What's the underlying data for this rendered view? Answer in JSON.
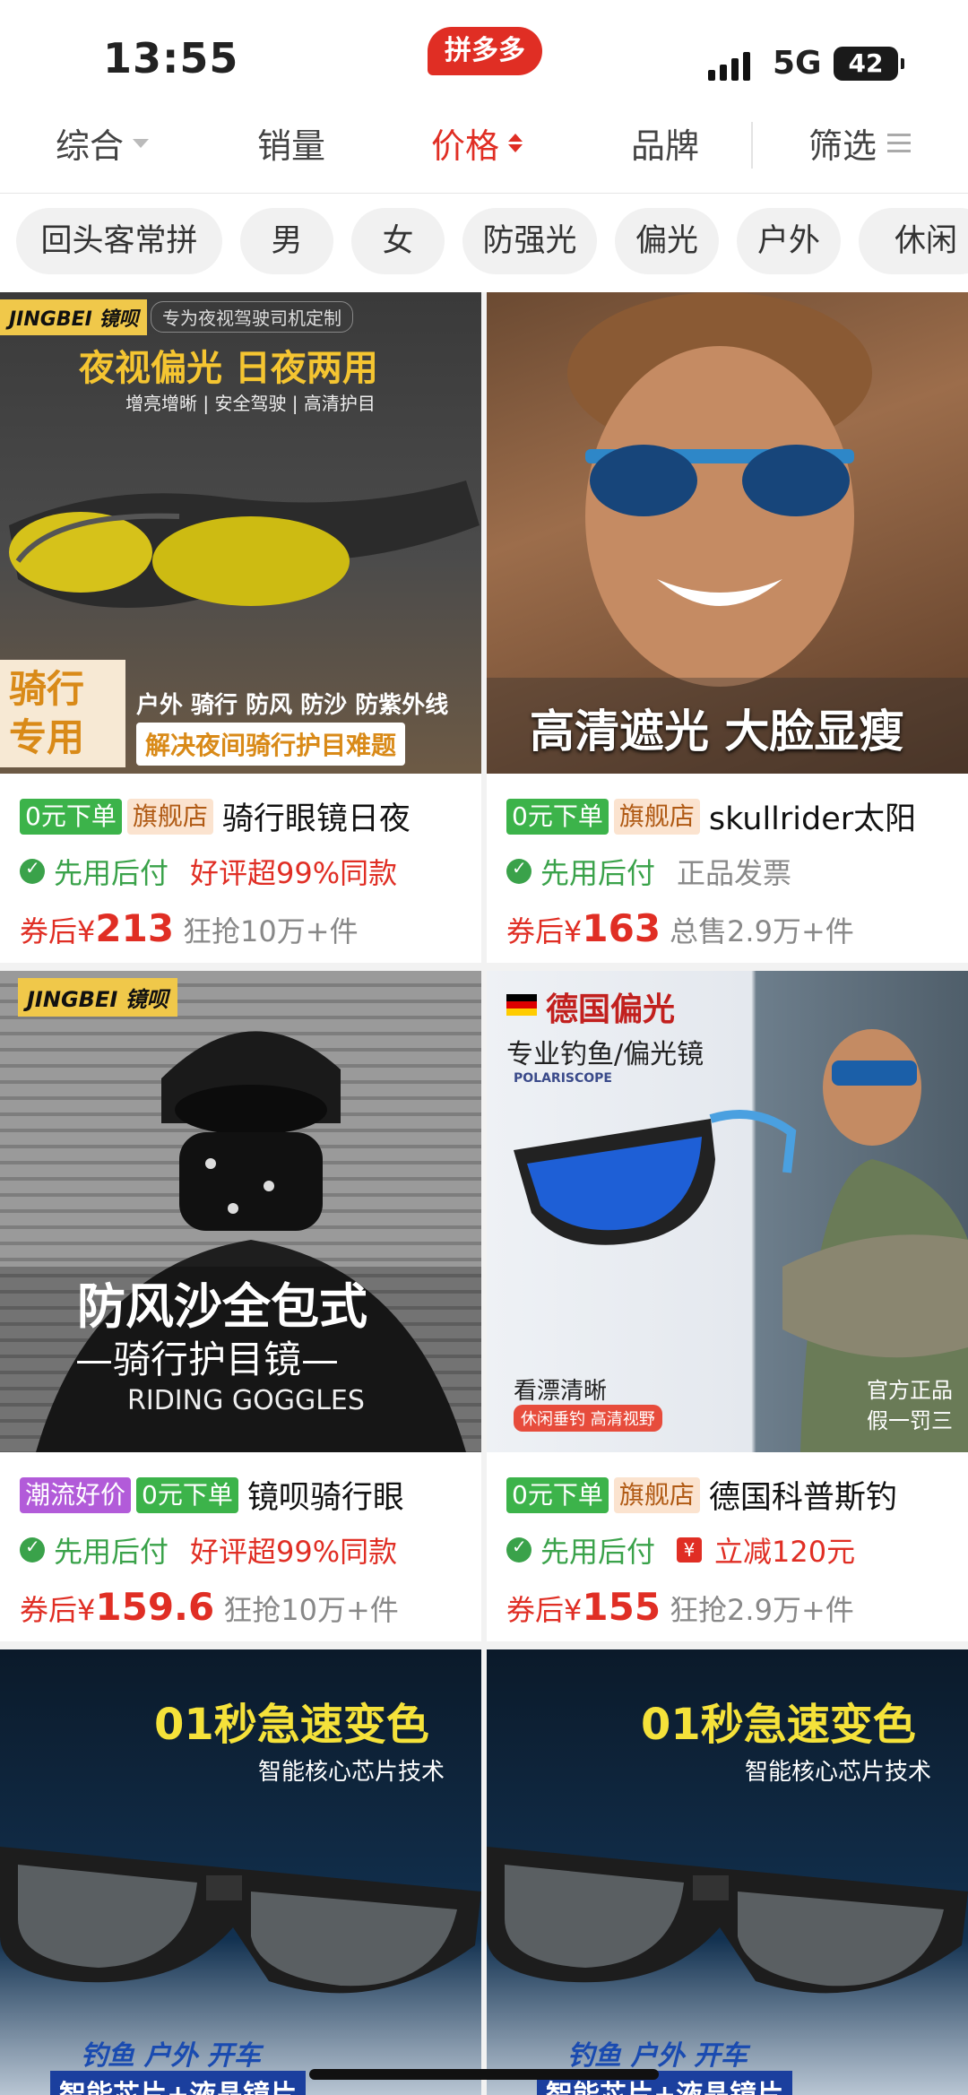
{
  "status": {
    "time": "13:55",
    "network": "5G",
    "battery": "42"
  },
  "app": {
    "badge": "拼多多"
  },
  "sort_tabs": [
    {
      "label": "综合"
    },
    {
      "label": "销量"
    },
    {
      "label": "价格",
      "active": true
    },
    {
      "label": "品牌"
    },
    {
      "label": "筛选"
    }
  ],
  "chips": [
    "回头客常拼",
    "男",
    "女",
    "防强光",
    "偏光",
    "户外",
    "休闲"
  ],
  "products": [
    {
      "image": {
        "brand": "JINGBEI 镜呗",
        "banner": "专为夜视驾驶司机定制",
        "headline": "夜视偏光 日夜两用",
        "sub": "增亮增晰 | 安全驾驶 | 高清护目",
        "badge_l1": "骑行",
        "badge_l2": "专用",
        "features": "户外 骑行 防风 防沙 防紫外线",
        "solve": "解决夜间骑行护目难题"
      },
      "tags": [
        "0元下单",
        "旗舰店"
      ],
      "title": "骑行眼镜日夜",
      "pay": "先用后付",
      "promo": "好评超99%同款",
      "coupon": "券后",
      "yen": "¥",
      "price": "213",
      "sold": "狂抢10万+件"
    },
    {
      "image": {
        "caption": "高清遮光 大脸显瘦"
      },
      "tags": [
        "0元下单",
        "旗舰店"
      ],
      "title": "skullrider太阳",
      "pay": "先用后付",
      "promo": "正品发票",
      "coupon": "券后",
      "yen": "¥",
      "price": "163",
      "sold": "总售2.9万+件"
    },
    {
      "image": {
        "brand": "JINGBEI 镜呗",
        "headline": "防风沙全包式",
        "sub": "—骑行护目镜—",
        "en": "RIDING GOGGLES"
      },
      "tags": [
        "潮流好价",
        "0元下单"
      ],
      "title": "镜呗骑行眼",
      "pay": "先用后付",
      "promo": "好评超99%同款",
      "coupon": "券后",
      "yen": "¥",
      "price": "159.6",
      "sold": "狂抢10万+件"
    },
    {
      "image": {
        "headline": "德国偏光",
        "sub": "专业钓鱼/偏光镜",
        "brand": "POLARISCOPE",
        "clear": "看漂清晰",
        "tag": "休闲垂钓 高清视野",
        "official": "官方正品",
        "fake": "假一罚三"
      },
      "tags": [
        "0元下单",
        "旗舰店"
      ],
      "title": "德国科普斯钓",
      "pay": "先用后付",
      "promo": "立减120元",
      "coupon": "券后",
      "yen": "¥",
      "price": "155",
      "sold": "狂抢2.9万+件"
    },
    {
      "image": {
        "headline": "01秒急速变色",
        "sub": "智能核心芯片技术",
        "uses": "钓鱼 户外 开车",
        "chip": "智能芯片+液晶镜片"
      }
    },
    {
      "image": {
        "headline": "01秒急速变色",
        "sub": "智能核心芯片技术",
        "uses": "钓鱼 户外 开车",
        "chip": "智能芯片+液晶镜片"
      }
    }
  ]
}
